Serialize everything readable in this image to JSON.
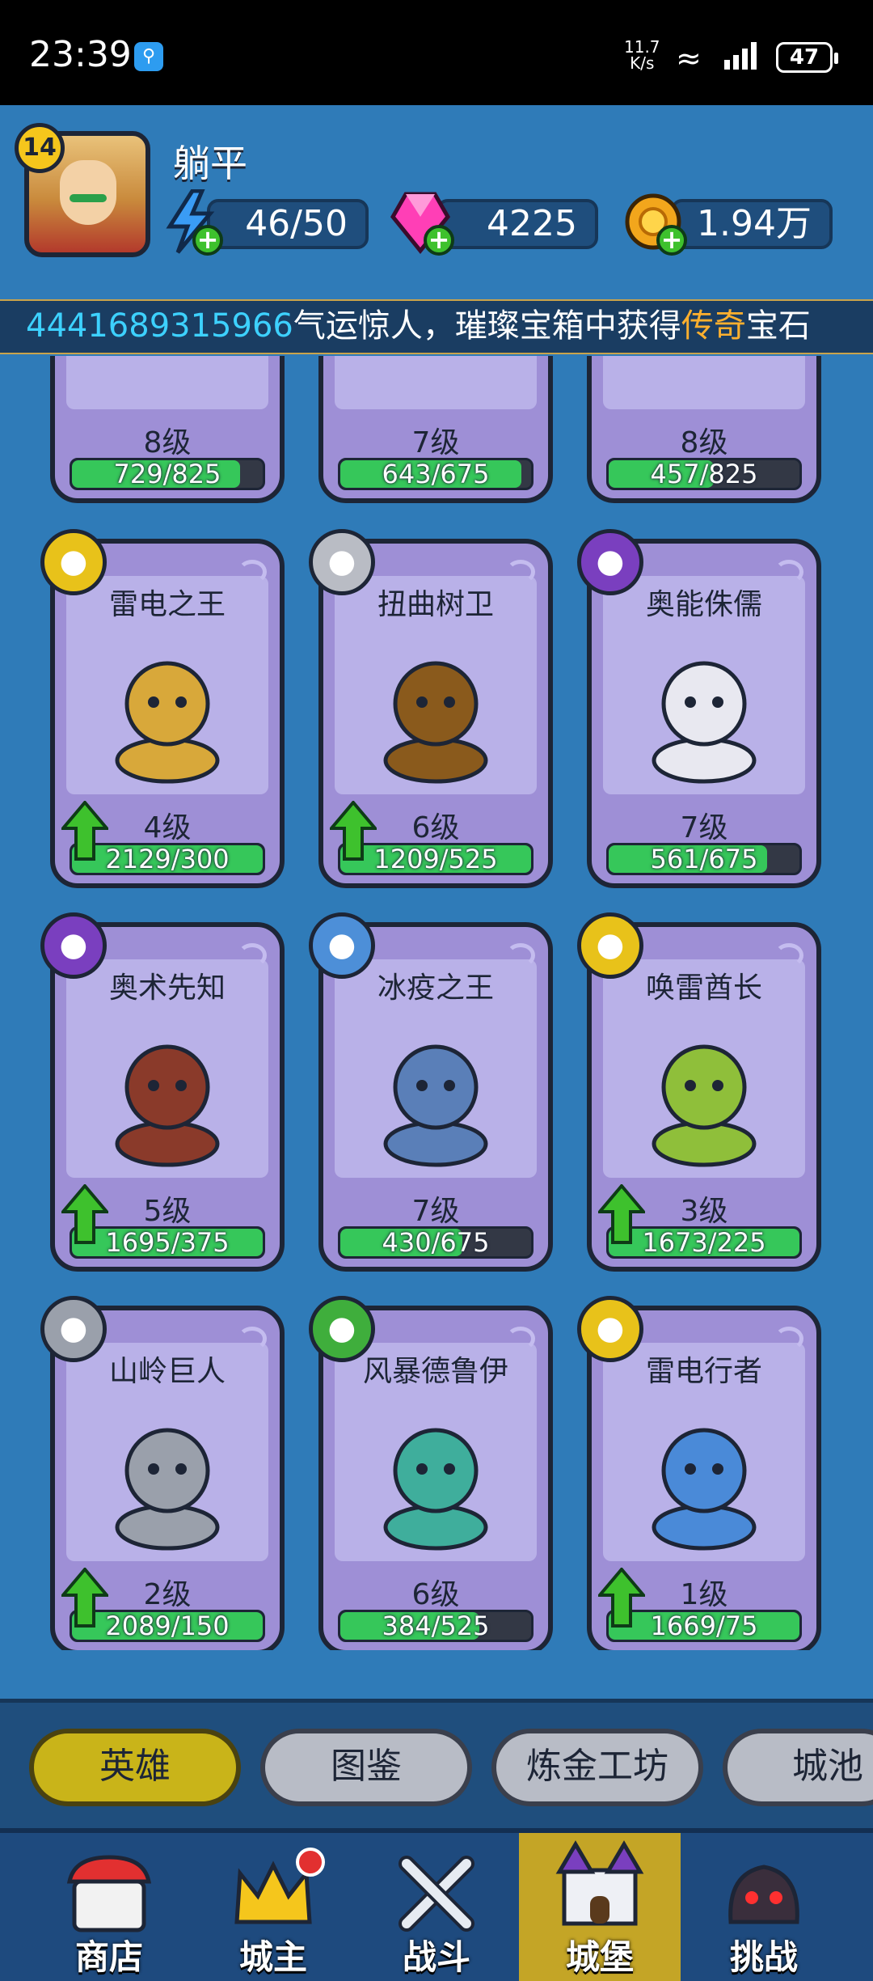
{
  "status_bar": {
    "time": "23:39",
    "net_speed_top": "11.7",
    "net_speed_bottom": "K/s",
    "battery": "47"
  },
  "player": {
    "level": "14",
    "name": "躺平",
    "energy": "46/50",
    "gems": "4225",
    "gold": "1.94万"
  },
  "marquee": {
    "player_id": "4441689315966",
    "text_part1": "气运惊人，璀璨宝箱中获得",
    "highlight": "传奇",
    "text_part2": "宝石"
  },
  "heroes_top_row": [
    {
      "level": "8级",
      "progress": "729/825",
      "fraction": 0.88
    },
    {
      "level": "7级",
      "progress": "643/675",
      "fraction": 0.95
    },
    {
      "level": "8级",
      "progress": "457/825",
      "fraction": 0.55
    }
  ],
  "heroes": [
    {
      "name": "雷电之王",
      "level": "4级",
      "progress": "2129/300",
      "fraction": 1.0,
      "upgradable": true,
      "element": "lightning-icon",
      "element_color": "#e8c21a"
    },
    {
      "name": "扭曲树卫",
      "level": "6级",
      "progress": "1209/525",
      "fraction": 1.0,
      "upgradable": true,
      "element": "helmet-icon",
      "element_color": "#b9bcc4"
    },
    {
      "name": "奥能侏儒",
      "level": "7级",
      "progress": "561/675",
      "fraction": 0.83,
      "upgradable": false,
      "element": "arcane-icon",
      "element_color": "#7a3fbf"
    },
    {
      "name": "奥术先知",
      "level": "5级",
      "progress": "1695/375",
      "fraction": 1.0,
      "upgradable": true,
      "element": "arrows-icon",
      "element_color": "#7a3fbf"
    },
    {
      "name": "冰疫之王",
      "level": "7级",
      "progress": "430/675",
      "fraction": 0.64,
      "upgradable": false,
      "element": "ice-crystal-icon",
      "element_color": "#4d8fd8"
    },
    {
      "name": "唤雷酋长",
      "level": "3级",
      "progress": "1673/225",
      "fraction": 1.0,
      "upgradable": true,
      "element": "lightning-icon",
      "element_color": "#e8c21a"
    },
    {
      "name": "山岭巨人",
      "level": "2级",
      "progress": "2089/150",
      "fraction": 1.0,
      "upgradable": true,
      "element": "mountain-icon",
      "element_color": "#9aa0ab"
    },
    {
      "name": "风暴德鲁伊",
      "level": "6级",
      "progress": "384/525",
      "fraction": 0.73,
      "upgradable": false,
      "element": "wind-icon",
      "element_color": "#3fae3c"
    },
    {
      "name": "雷电行者",
      "level": "1级",
      "progress": "1669/75",
      "fraction": 1.0,
      "upgradable": true,
      "element": "lightning-icon",
      "element_color": "#e8c21a"
    }
  ],
  "tabs": [
    "英雄",
    "图鉴",
    "炼金工坊",
    "城池"
  ],
  "nav": {
    "shop": "商店",
    "lord": "城主",
    "battle": "战斗",
    "castle": "城堡",
    "challenge": "挑战"
  },
  "colors": {
    "background": "#2f7bb8",
    "card": "#9e8fd6",
    "progress_green": "#36c75a",
    "active_tab": "#c9b419",
    "highlight": "#ffb02e"
  }
}
